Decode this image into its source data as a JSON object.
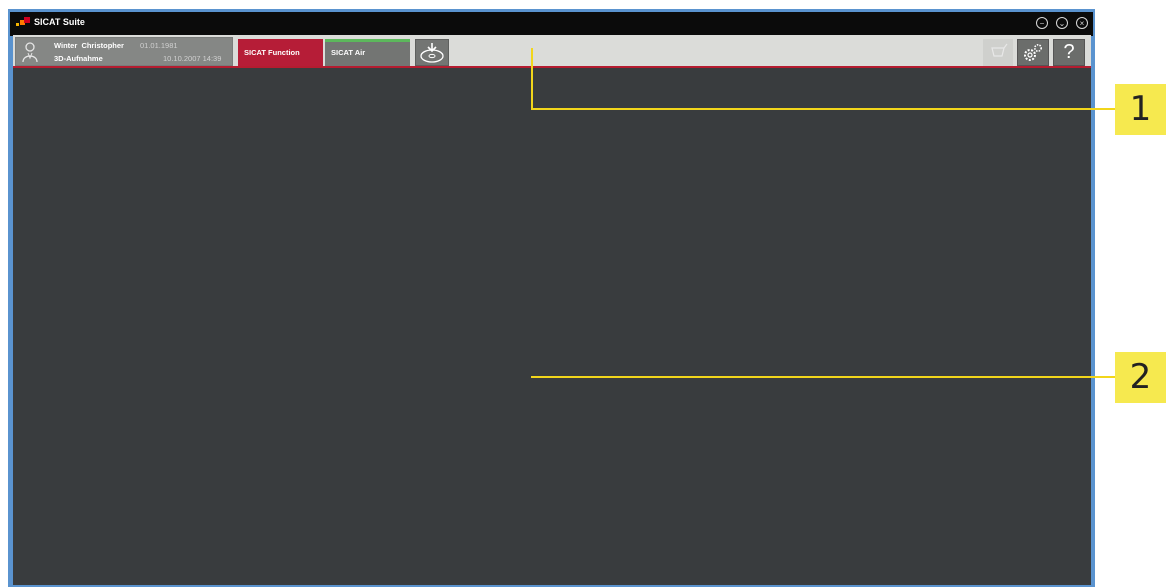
{
  "window": {
    "title": "SICAT Suite",
    "controls": {
      "minimize": "−",
      "restore": "⌄",
      "close": "×"
    }
  },
  "patient": {
    "last_name": "Winter",
    "first_name": "Christopher",
    "birth_date": "01.01.1981",
    "study_type": "3D-Aufnahme",
    "study_date": "10.10.2007 14:39"
  },
  "tabs": [
    {
      "label": "SICAT Function",
      "active": true
    },
    {
      "label": "SICAT Air",
      "active": false
    }
  ],
  "toolbar": {
    "help_label": "?"
  },
  "callouts": [
    {
      "number": "1"
    },
    {
      "number": "2"
    }
  ],
  "colors": {
    "window_border": "#5a93cf",
    "workspace_bg": "#393c3e",
    "toolbar_bg": "#dbdcd9",
    "active_tab": "#b61d37",
    "callout_accent": "#f6e94f"
  }
}
